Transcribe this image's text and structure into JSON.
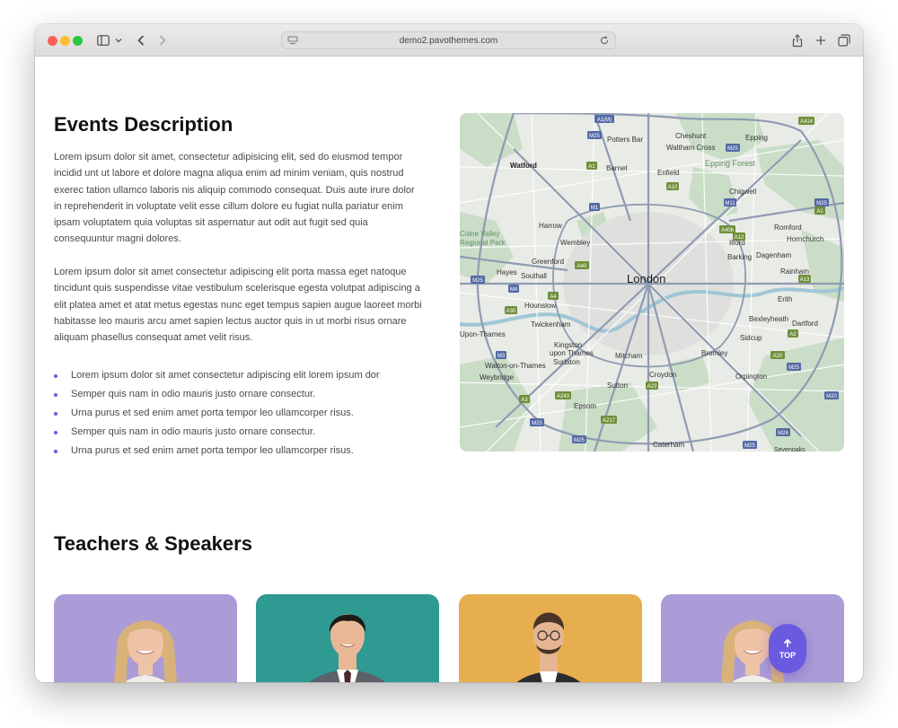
{
  "browser": {
    "url": "demo2.pavothemes.com",
    "icons": [
      "sidebar-icon",
      "chevron-down-icon",
      "back-icon",
      "forward-icon",
      "reload-icon",
      "share-icon",
      "new-tab-icon",
      "tabs-overview-icon"
    ]
  },
  "events": {
    "title": "Events Description",
    "paragraph1": "Lorem ipsum dolor sit amet, consectetur adipisicing elit, sed do eiusmod tempor incidid unt ut labore et dolore magna aliqua enim ad minim veniam, quis nostrud exerec tation ullamco laboris nis aliquip commodo consequat. Duis aute irure dolor in reprehenderit in voluptate velit esse cillum dolore eu fugiat nulla pariatur enim ipsam voluptatem quia voluptas sit aspernatur aut odit aut fugit sed quia consequuntur magni dolores.",
    "paragraph2": "Lorem ipsum dolor sit amet consectetur adipiscing elit porta massa eget natoque tincidunt quis suspendisse vitae vestibulum scelerisque egesta volutpat adipiscing a elit platea amet et atat metus egestas nunc eget tempus sapien augue laoreet morbi habitasse leo mauris arcu amet sapien lectus auctor quis in ut morbi risus ornare aliquam phasellus consequat amet velit risus.",
    "bullets": [
      "Lorem ipsum dolor sit amet consectetur adipiscing elit lorem ipsum dor",
      "Semper quis nam in odio mauris justo ornare consectur.",
      "Urna purus et sed enim amet porta tempor leo ullamcorper risus.",
      "Semper quis nam in odio mauris justo ornare consectur.",
      "Urna purus et sed enim amet porta tempor leo ullamcorper risus."
    ]
  },
  "map": {
    "center_label": "London",
    "places": [
      "Potters Bar",
      "Cheshunt",
      "Epping",
      "Waltham Cross",
      "Watford",
      "Barnet",
      "Enfield",
      "Epping Forest",
      "Chigwell",
      "Harrow",
      "Romford",
      "Colne Valley Regional Park",
      "Wembley",
      "Ilford",
      "Hornchurch",
      "Greenford",
      "Barking",
      "Dagenham",
      "Hayes",
      "Southall",
      "Rainham",
      "Erith",
      "Hounslow",
      "Bexleyheath",
      "Dartford",
      "Twickenham",
      "Sidcup",
      "Upon-Thames",
      "Kingston upon Thames",
      "Mitcham",
      "Bromley",
      "Surbiton",
      "Walton-on-Thames",
      "Croydon",
      "Orpington",
      "Weybridge",
      "Sutton",
      "Epsom",
      "Caterham",
      "Sevenoaks"
    ],
    "road_badges": [
      "A1(M)",
      "M25",
      "A414",
      "A1",
      "M25",
      "A10",
      "M11",
      "M25",
      "A1",
      "M1",
      "A406",
      "A12",
      "A40",
      "A13",
      "M25",
      "M4",
      "A4",
      "A30",
      "A2",
      "A20",
      "M3",
      "A3",
      "A243",
      "A23",
      "A217",
      "M25",
      "M26",
      "M20",
      "M25",
      "M25",
      "A21"
    ]
  },
  "teachers": {
    "title": "Teachers & Speakers",
    "cards": [
      {
        "bg": "#ab9bd6",
        "shirt": "#f3ede7",
        "hair": "#d9b27a",
        "skin": "#efc3a6",
        "accent": "#8f5aa6"
      },
      {
        "bg": "#2e9a92",
        "shirt": "#5d6169",
        "hair": "#1e1a18",
        "skin": "#e8b896",
        "accent": "#4a2530"
      },
      {
        "bg": "#e6ae4e",
        "shirt": "#2c2c30",
        "hair": "#4a3426",
        "skin": "#e6b592",
        "accent": "#ffffff"
      },
      {
        "bg": "#ab9bd6",
        "shirt": "#f3ede7",
        "hair": "#d9b27a",
        "skin": "#efc3a6",
        "accent": "#8f5aa6"
      }
    ]
  },
  "top_button": {
    "label": "TOP"
  },
  "colors": {
    "accent": "#6a5ae0",
    "heading": "#111111",
    "body_text": "#4a4a4a"
  }
}
